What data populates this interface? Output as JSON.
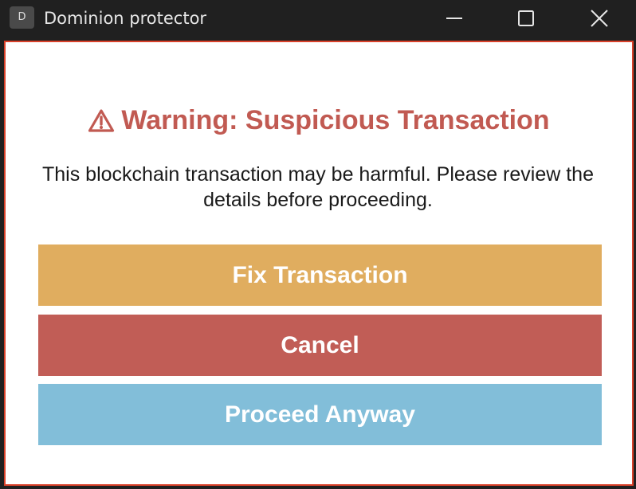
{
  "window": {
    "icon_letter": "D",
    "title": "Dominion protector"
  },
  "dialog": {
    "heading": "Warning: Suspicious Transaction",
    "message": "This blockchain transaction may be harmful. Please review the details before proceeding."
  },
  "actions": {
    "fix_label": "Fix Transaction",
    "cancel_label": "Cancel",
    "proceed_label": "Proceed Anyway"
  },
  "colors": {
    "titlebar": "#202020",
    "frame_border": "#d9412a",
    "heading": "#c15a52",
    "fix_button": "#e0ad5f",
    "cancel_button": "#c15d56",
    "proceed_button": "#82bed9"
  },
  "icons": {
    "app": "app-icon",
    "minimize": "minimize-icon",
    "maximize": "maximize-icon",
    "close": "close-icon",
    "heading": "warning-icon"
  }
}
